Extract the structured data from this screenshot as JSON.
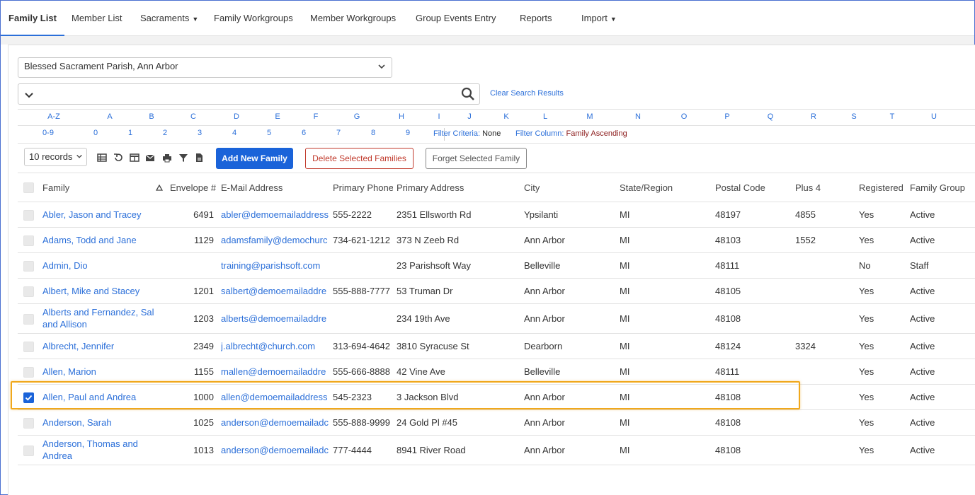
{
  "nav": {
    "items": [
      {
        "label": "Family List",
        "active": true
      },
      {
        "label": "Member List"
      },
      {
        "label": "Sacraments",
        "dropdown": true
      },
      {
        "label": "Family Workgroups"
      },
      {
        "label": "Member Workgroups"
      },
      {
        "label": "Group Events Entry"
      },
      {
        "label": "Reports"
      },
      {
        "label": "Import",
        "dropdown": true
      }
    ]
  },
  "parish_select": {
    "value": "Blessed Sacrament Parish, Ann Arbor"
  },
  "search": {
    "value": "",
    "clear_label": "Clear Search Results"
  },
  "alpha_filter": {
    "letters": [
      "A-Z",
      "A",
      "B",
      "C",
      "D",
      "E",
      "F",
      "G",
      "H",
      "I",
      "J",
      "K",
      "L",
      "M",
      "N",
      "O",
      "P",
      "Q",
      "R",
      "S",
      "T",
      "U"
    ],
    "numbers": [
      "0-9",
      "0",
      "1",
      "2",
      "3",
      "4",
      "5",
      "6",
      "7",
      "8",
      "9"
    ]
  },
  "filter_info": {
    "criteria_label": "Filter Criteria:",
    "criteria_value": "None",
    "column_label": "Filter Column:",
    "column_value": "Family Ascending"
  },
  "toolbar": {
    "records_value": "10 records",
    "add_label": "Add New Family",
    "delete_label": "Delete Selected Families",
    "forget_label": "Forget Selected Family",
    "icons": [
      "table-icon",
      "undo-icon",
      "columns-icon",
      "mail-icon",
      "print-icon",
      "filter-icon",
      "export-icon"
    ]
  },
  "table": {
    "columns": [
      "Family",
      "Envelope #",
      "E-Mail Address",
      "Primary Phone",
      "Primary Address",
      "City",
      "State/Region",
      "Postal Code",
      "Plus 4",
      "Registered",
      "Family Group"
    ],
    "rows": [
      {
        "family": "Abler, Jason and Tracey",
        "envelope": "6491",
        "email": "abler@demoemailaddress",
        "phone": "555-2222",
        "address": "2351 Ellsworth Rd",
        "city": "Ypsilanti",
        "state": "MI",
        "postal": "48197",
        "plus4": "4855",
        "registered": "Yes",
        "group": "Active",
        "checked": false
      },
      {
        "family": "Adams, Todd and Jane",
        "envelope": "1129",
        "email": "adamsfamily@demochurc",
        "phone": "734-621-1212",
        "address": "373 N Zeeb Rd",
        "city": "Ann Arbor",
        "state": "MI",
        "postal": "48103",
        "plus4": "1552",
        "registered": "Yes",
        "group": "Active",
        "checked": false
      },
      {
        "family": "Admin, Dio",
        "envelope": "",
        "email": "training@parishsoft.com",
        "phone": "",
        "address": "23 Parishsoft Way",
        "city": "Belleville",
        "state": "MI",
        "postal": "48111",
        "plus4": "",
        "registered": "No",
        "group": "Staff",
        "checked": false
      },
      {
        "family": "Albert, Mike and Stacey",
        "envelope": "1201",
        "email": "salbert@demoemailaddre",
        "phone": "555-888-7777",
        "address": "53 Truman Dr",
        "city": "Ann Arbor",
        "state": "MI",
        "postal": "48105",
        "plus4": "",
        "registered": "Yes",
        "group": "Active",
        "checked": false
      },
      {
        "family": "Alberts and Fernandez, Sal and Allison",
        "envelope": "1203",
        "email": "alberts@demoemailaddre",
        "phone": "",
        "address": "234 19th Ave",
        "city": "Ann Arbor",
        "state": "MI",
        "postal": "48108",
        "plus4": "",
        "registered": "Yes",
        "group": "Active",
        "checked": false
      },
      {
        "family": "Albrecht, Jennifer",
        "envelope": "2349",
        "email": "j.albrecht@church.com",
        "phone": "313-694-4642",
        "address": "3810 Syracuse St",
        "city": "Dearborn",
        "state": "MI",
        "postal": "48124",
        "plus4": "3324",
        "registered": "Yes",
        "group": "Active",
        "checked": false
      },
      {
        "family": "Allen, Marion",
        "envelope": "1155",
        "email": "mallen@demoemailaddre",
        "phone": "555-666-8888",
        "address": "42 Vine Ave",
        "city": "Belleville",
        "state": "MI",
        "postal": "48111",
        "plus4": "",
        "registered": "Yes",
        "group": "Active",
        "checked": false
      },
      {
        "family": "Allen, Paul and Andrea",
        "envelope": "1000",
        "email": "allen@demoemailaddress",
        "phone": "545-2323",
        "address": "3 Jackson Blvd",
        "city": "Ann Arbor",
        "state": "MI",
        "postal": "48108",
        "plus4": "",
        "registered": "Yes",
        "group": "Active",
        "checked": true
      },
      {
        "family": "Anderson, Sarah",
        "envelope": "1025",
        "email": "anderson@demoemailadc",
        "phone": "555-888-9999",
        "address": "24 Gold Pl #45",
        "city": "Ann Arbor",
        "state": "MI",
        "postal": "48108",
        "plus4": "",
        "registered": "Yes",
        "group": "Active",
        "checked": false
      },
      {
        "family": "Anderson, Thomas and Andrea",
        "envelope": "1013",
        "email": "anderson@demoemailadc",
        "phone": "777-4444",
        "address": "8941 River Road",
        "city": "Ann Arbor",
        "state": "MI",
        "postal": "48108",
        "plus4": "",
        "registered": "Yes",
        "group": "Active",
        "checked": false
      }
    ]
  },
  "colors": {
    "accent": "#1a63d9",
    "link": "#2b6fd9",
    "danger": "#c0392b",
    "highlight": "#f0a81c"
  }
}
